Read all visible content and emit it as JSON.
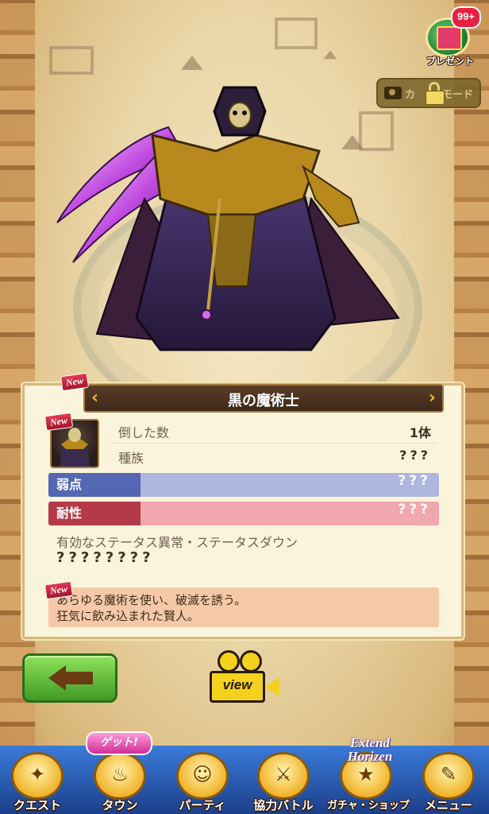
{
  "gift": {
    "badge": "99+",
    "label": "プレゼント"
  },
  "camera_mode": {
    "label_prefix": "カ",
    "label_suffix": "モード",
    "locked": true
  },
  "monster": {
    "name": "黒の魔術士",
    "new_tag": "New",
    "rows": [
      {
        "label": "倒した数",
        "value": "1体"
      },
      {
        "label": "種族",
        "value": "???"
      }
    ],
    "weakness": {
      "label": "弱点",
      "value": "???",
      "color": "#5367b3"
    },
    "resistance": {
      "label": "耐性",
      "value": "???",
      "color": "#b53a49"
    },
    "status_effects": {
      "label": "有効なステータス異常・ステータスダウン",
      "value": "????????"
    },
    "description": {
      "line1": "あらゆる魔術を使い、破滅を誘う。",
      "line2": "狂気に飲み込まれた賢人。"
    }
  },
  "view_button": {
    "label": "view"
  },
  "nav": {
    "get_badge": "ゲット!",
    "extend_line1": "Extend",
    "extend_line2": "Horizen",
    "items": [
      {
        "label": "クエスト",
        "icon": "quest-map-icon",
        "glyph": "✦"
      },
      {
        "label": "タウン",
        "icon": "town-cauldron-icon",
        "glyph": "♨"
      },
      {
        "label": "パーティ",
        "icon": "party-people-icon",
        "glyph": "☺"
      },
      {
        "label": "協力バトル",
        "icon": "coop-shield-icon",
        "glyph": "⚔"
      },
      {
        "label": "ガチャ・ショップ",
        "icon": "gacha-star-icon",
        "glyph": "★"
      },
      {
        "label": "メニュー",
        "icon": "menu-scroll-icon",
        "glyph": "✎"
      }
    ]
  }
}
